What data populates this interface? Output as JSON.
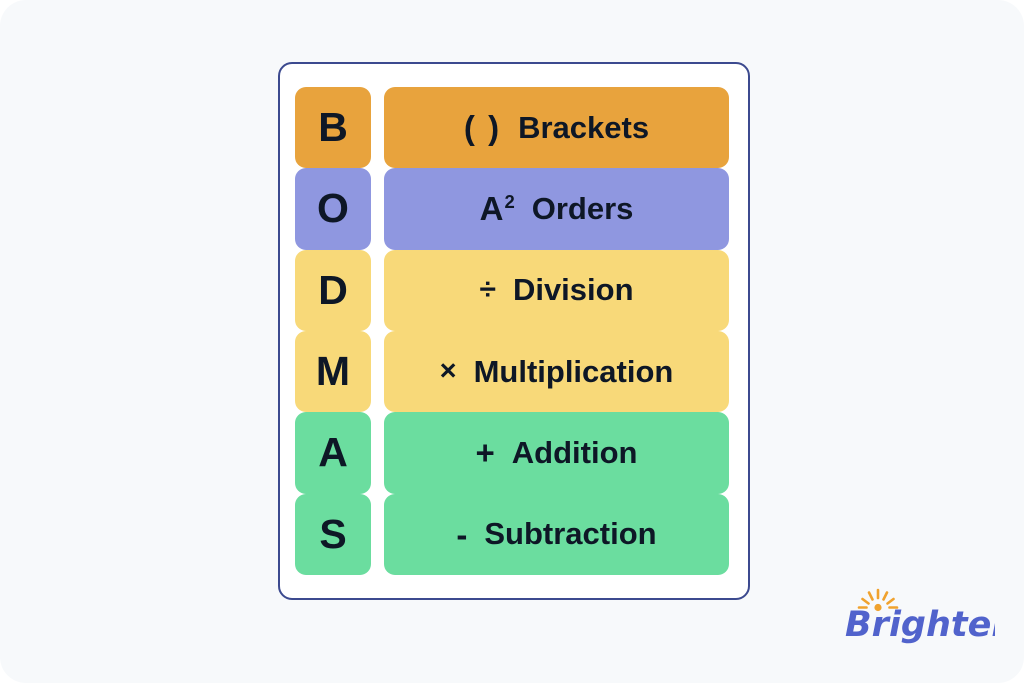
{
  "page": {
    "background_color": "#f7f9fb"
  },
  "card": {
    "border_color": "#3c4a8f",
    "background_color": "#ffffff",
    "rows": [
      {
        "letter": "B",
        "symbol": "( )",
        "word": "Brackets",
        "color": "#e8a33d",
        "symbol_kind": "brackets",
        "letter_name": "letter-tile-b",
        "label_name": "label-tile-brackets"
      },
      {
        "letter": "O",
        "symbol": "A",
        "superscript": "2",
        "word": "Orders",
        "color": "#8f97e0",
        "symbol_kind": "power",
        "letter_name": "letter-tile-o",
        "label_name": "label-tile-orders"
      },
      {
        "letter": "D",
        "symbol": "÷",
        "word": "Division",
        "color": "#f8d979",
        "symbol_kind": "divide",
        "letter_name": "letter-tile-d",
        "label_name": "label-tile-division"
      },
      {
        "letter": "M",
        "symbol": "×",
        "word": "Multiplication",
        "color": "#f8d979",
        "symbol_kind": "times",
        "letter_name": "letter-tile-m",
        "label_name": "label-tile-multiplication"
      },
      {
        "letter": "A",
        "symbol": "+",
        "word": "Addition",
        "color": "#6bdd9f",
        "symbol_kind": "plus",
        "letter_name": "letter-tile-a",
        "label_name": "label-tile-addition"
      },
      {
        "letter": "S",
        "symbol": "-",
        "word": "Subtraction",
        "color": "#6bdd9f",
        "symbol_kind": "minus",
        "letter_name": "letter-tile-s",
        "label_name": "label-tile-subtraction"
      }
    ]
  },
  "logo": {
    "text": "Brighterly",
    "text_color": "#5163cc",
    "sunburst_color": "#f0a22e",
    "icon_name": "sunburst-icon"
  }
}
